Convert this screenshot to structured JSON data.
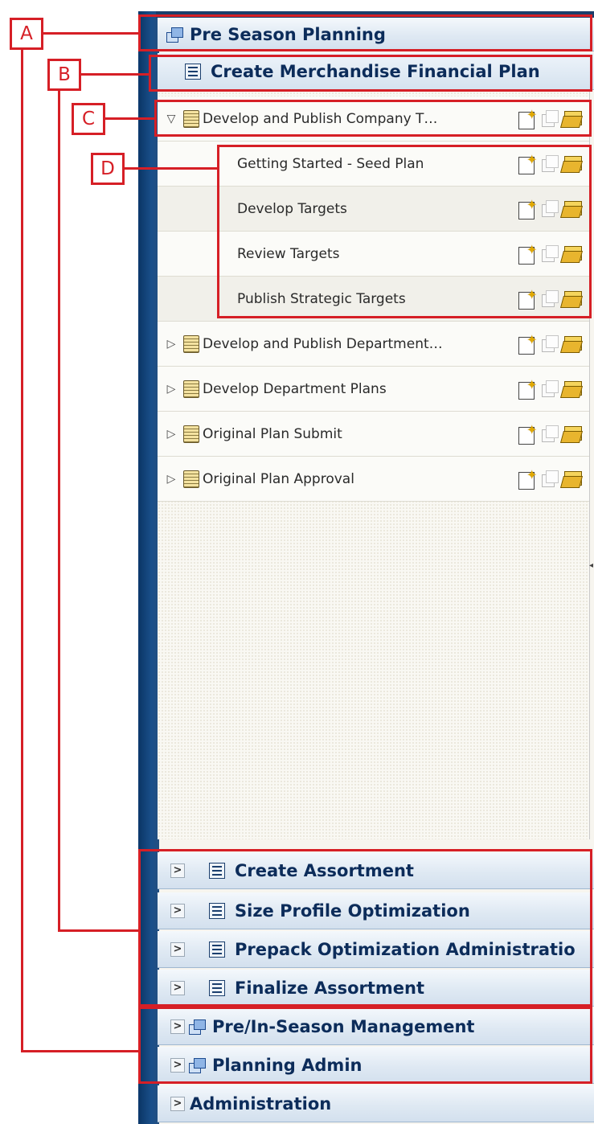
{
  "header": {
    "title": "Pre Season Planning"
  },
  "workflow": {
    "title": "Create Merchandise Financial Plan"
  },
  "tree": [
    {
      "label": "Develop and Publish Company T…",
      "expanded": true,
      "level": 0
    },
    {
      "label": "Getting Started - Seed Plan",
      "level": 1
    },
    {
      "label": "Develop Targets",
      "level": 1
    },
    {
      "label": "Review Targets",
      "level": 1
    },
    {
      "label": "Publish Strategic Targets",
      "level": 1
    },
    {
      "label": "Develop and Publish Department…",
      "expanded": false,
      "level": 0
    },
    {
      "label": "Develop Department Plans",
      "expanded": false,
      "level": 0
    },
    {
      "label": "Original Plan Submit",
      "expanded": false,
      "level": 0
    },
    {
      "label": "Original Plan Approval",
      "expanded": false,
      "level": 0
    }
  ],
  "workflows": [
    {
      "label": "Create Assortment"
    },
    {
      "label": "Size Profile Optimization"
    },
    {
      "label": "Prepack Optimization Administratio"
    },
    {
      "label": "Finalize Assortment"
    }
  ],
  "tasks": [
    {
      "label": "Pre/In-Season Management"
    },
    {
      "label": "Planning Admin"
    }
  ],
  "admin": {
    "label": "Administration"
  },
  "callouts": {
    "a": "A",
    "b": "B",
    "c": "C",
    "d": "D"
  },
  "icons": {
    "tree_toggle_expanded": "triangle-down-icon",
    "tree_toggle_collapsed": "triangle-right-icon",
    "task_list": "notepad-icon",
    "action_new": "new-document-icon",
    "action_disabled": "pages-disabled-icon",
    "action_open": "open-folder-icon",
    "section_collapsed": "chevron-right-icon",
    "activity": "windows-icon",
    "workflow": "list-icon"
  },
  "colors": {
    "highlight": "#d61f26",
    "header_text": "#0c2c5a",
    "frame": "#0c3869"
  }
}
